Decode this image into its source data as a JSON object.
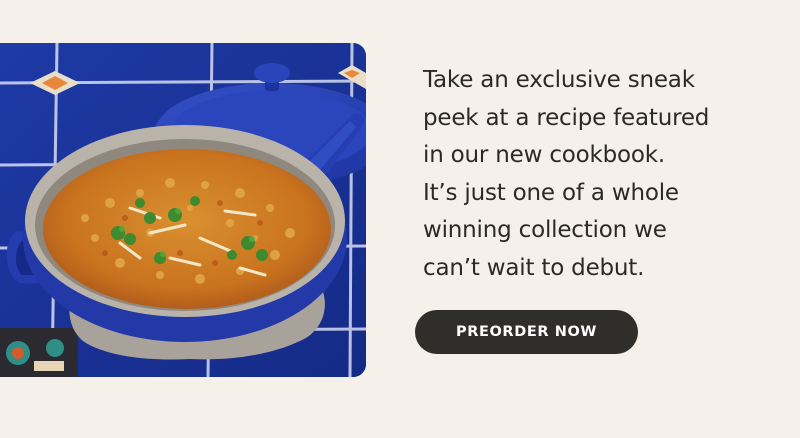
{
  "promo": {
    "lines": [
      "Take an exclusive sneak",
      "peek at a recipe featured",
      "in our new cookbook.",
      "It’s just one of a whole",
      "winning collection we",
      "can’t wait to debut."
    ],
    "cta_label": "PREORDER NOW"
  },
  "photo": {
    "icon": "pan-with-recipe-photo"
  },
  "colors": {
    "background": "#f5f1ea",
    "text": "#2b2a27",
    "button": "#2f2e2b",
    "button_text": "#ffffff",
    "cookware_blue": "#2a43b7"
  }
}
